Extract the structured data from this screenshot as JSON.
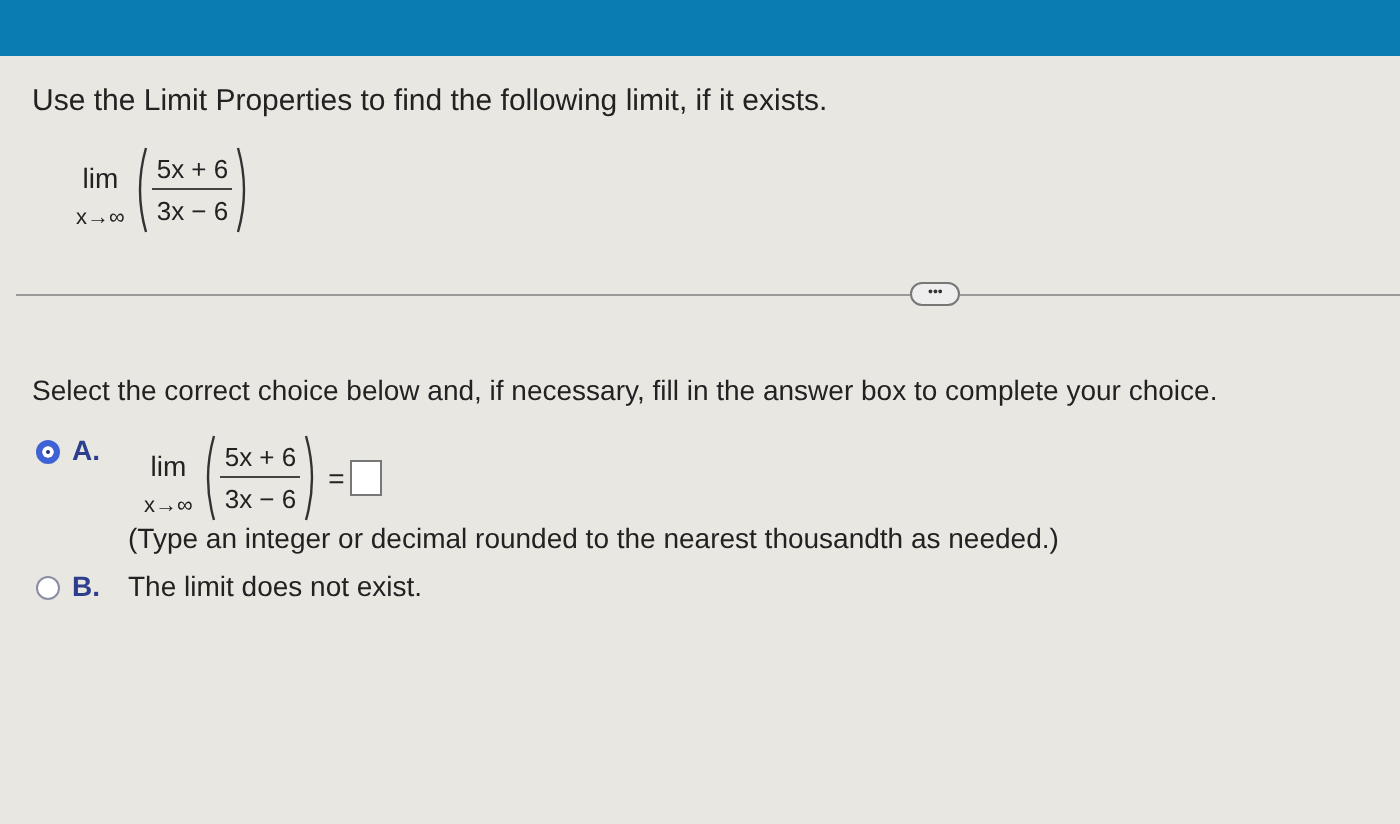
{
  "question": "Use the Limit Properties to find the following limit, if it exists.",
  "limit": {
    "operator": "lim",
    "subscript": "x→∞",
    "numerator": "5x + 6",
    "denominator": "3x − 6"
  },
  "more_button": {
    "label": "•••"
  },
  "instruction": "Select the correct choice below and, if necessary, fill in the answer box to complete your choice.",
  "choices": [
    {
      "letter": "A.",
      "selected": true,
      "kind": "limit_answer",
      "limit": {
        "operator": "lim",
        "subscript": "x→∞",
        "numerator": "5x + 6",
        "denominator": "3x − 6"
      },
      "equals": "=",
      "hint": "(Type an integer or decimal rounded to the nearest thousandth as needed.)"
    },
    {
      "letter": "B.",
      "selected": false,
      "kind": "text",
      "text": "The limit does not exist."
    }
  ]
}
